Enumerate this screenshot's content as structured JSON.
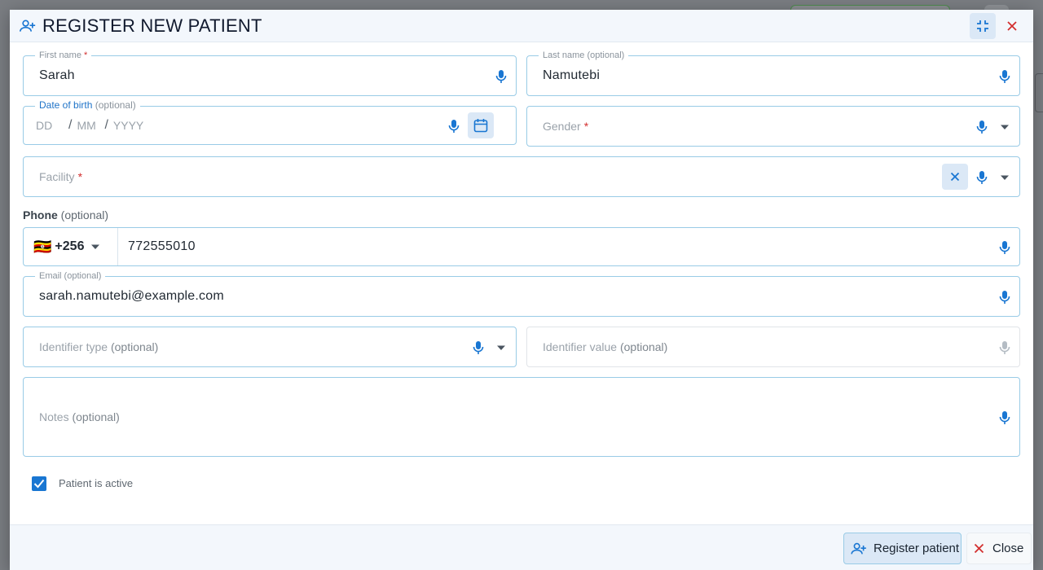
{
  "background": {
    "title": "",
    "chip": ""
  },
  "dialog": {
    "title": "REGISTER NEW PATIENT",
    "icons": {
      "header": "person-add-icon",
      "fullscreen": "fullscreen-exit-icon",
      "close": "close-icon",
      "mic": "microphone-icon",
      "calendar": "calendar-icon",
      "clear": "clear-icon",
      "dropdown": "arrow-drop-down-icon"
    },
    "colors": {
      "accent": "#1976d2",
      "required": "#d32f2f",
      "field_border": "#99cbe6",
      "header_bg": "#f3f7fc"
    }
  },
  "form": {
    "first_name": {
      "label": "First name",
      "required": "*",
      "value": "Sarah"
    },
    "last_name": {
      "label": "Last name",
      "optional": "(optional)",
      "value": "Namutebi"
    },
    "dob": {
      "label": "Date of birth",
      "optional": "(optional)",
      "dd": "DD",
      "mm": "MM",
      "yyyy": "YYYY",
      "separator": "/"
    },
    "gender": {
      "placeholder": "Gender",
      "required": "*"
    },
    "facility": {
      "placeholder": "Facility",
      "required": "*"
    },
    "phone": {
      "label": "Phone",
      "optional": "(optional)",
      "flag": "🇺🇬",
      "country_code": "+256",
      "value": "772555010"
    },
    "email": {
      "label": "Email (optional)",
      "value": "sarah.namutebi@example.com"
    },
    "identifier_type": {
      "placeholder": "Identifier type",
      "optional": "(optional)"
    },
    "identifier_value": {
      "placeholder": "Identifier value",
      "optional": "(optional)"
    },
    "notes": {
      "placeholder": "Notes",
      "optional": "(optional)"
    },
    "active": {
      "label": "Patient is active",
      "checked": true
    }
  },
  "footer": {
    "register_label": "Register patient",
    "close_label": "Close"
  }
}
